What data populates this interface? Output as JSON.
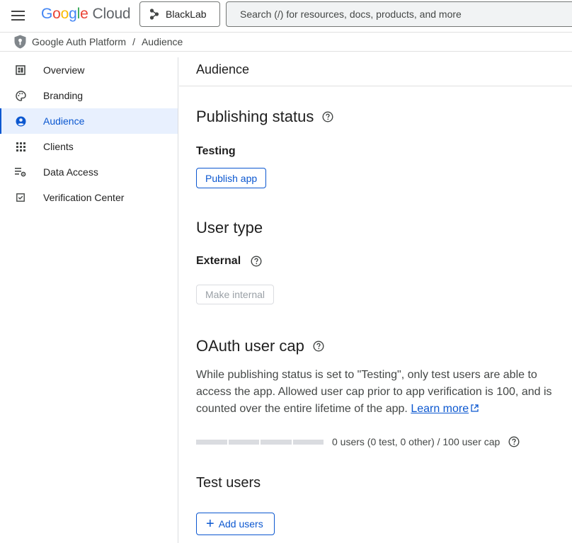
{
  "header": {
    "logo_google": [
      "G",
      "o",
      "o",
      "g",
      "l",
      "e"
    ],
    "logo_cloud": "Cloud",
    "project_name": "BlackLab",
    "search_placeholder": "Search (/) for resources, docs, products, and more"
  },
  "breadcrumb": {
    "items": [
      "Google Auth Platform",
      "Audience"
    ],
    "separator": "/"
  },
  "sidebar": {
    "items": [
      {
        "label": "Overview",
        "icon": "dashboard-icon"
      },
      {
        "label": "Branding",
        "icon": "palette-icon"
      },
      {
        "label": "Audience",
        "icon": "account-circle-icon",
        "active": true
      },
      {
        "label": "Clients",
        "icon": "apps-grid-icon"
      },
      {
        "label": "Data Access",
        "icon": "data-settings-icon"
      },
      {
        "label": "Verification Center",
        "icon": "checklist-icon"
      }
    ]
  },
  "main": {
    "page_title": "Audience",
    "publishing": {
      "heading": "Publishing status",
      "status": "Testing",
      "button": "Publish app"
    },
    "user_type": {
      "heading": "User type",
      "value": "External",
      "button": "Make internal"
    },
    "oauth_cap": {
      "heading": "OAuth user cap",
      "description": "While publishing status is set to \"Testing\", only test users are able to access the app. Allowed user cap prior to app verification is 100, and is counted over the entire lifetime of the app.",
      "learn_more": "Learn more",
      "usage_text": "0 users (0 test, 0 other) / 100 user cap",
      "usage_fraction": 0
    },
    "test_users": {
      "heading": "Test users",
      "button": "Add users"
    }
  },
  "colors": {
    "accent": "#0b57d0",
    "active_bg": "#e8f0fe"
  }
}
